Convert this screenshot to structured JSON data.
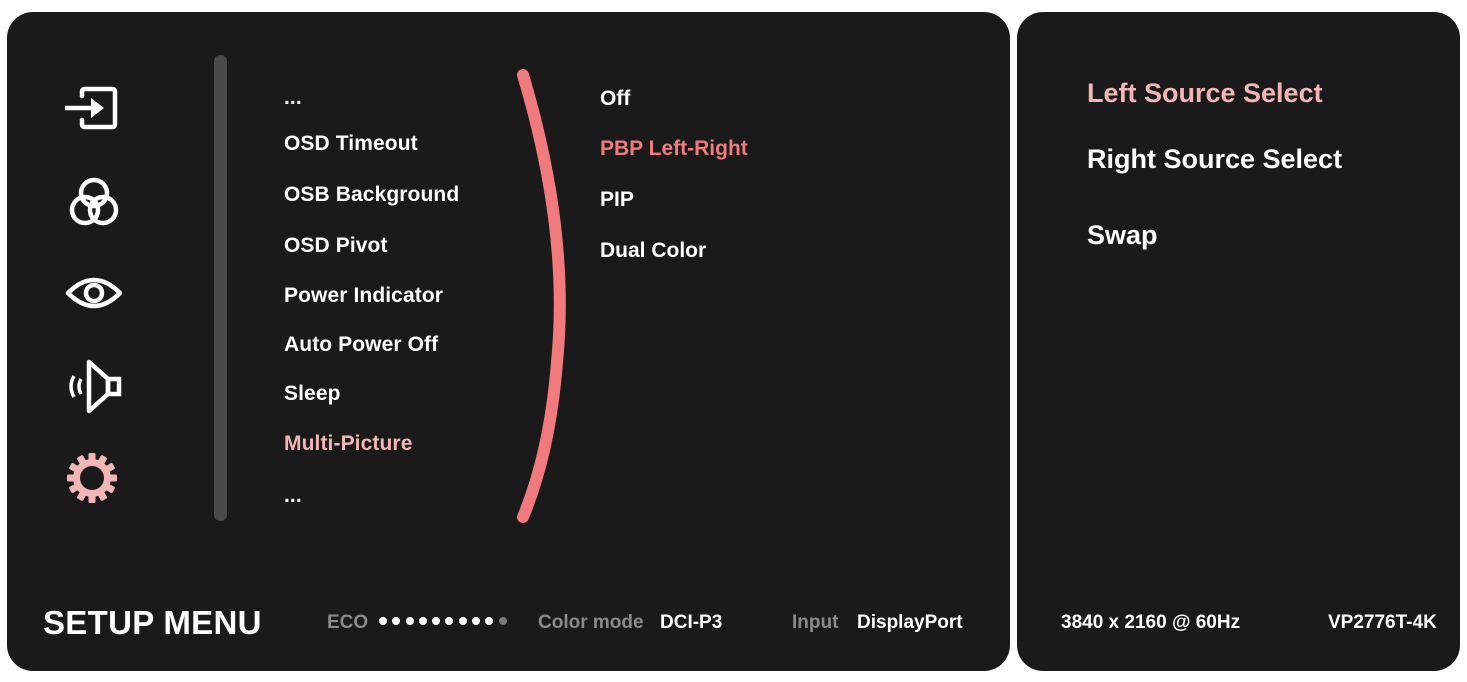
{
  "colors": {
    "panel_bg": "#1a1a1a",
    "active_pink": "#f2b6b6",
    "selected_coral": "#f07a7e",
    "scrollbar": "#4a4a4a",
    "muted_label": "#8a8a8a"
  },
  "sidebar": {
    "icons": [
      {
        "name": "input-source-icon",
        "active": false
      },
      {
        "name": "color-adjust-icon",
        "active": false
      },
      {
        "name": "view-mode-icon",
        "active": false
      },
      {
        "name": "audio-icon",
        "active": false
      },
      {
        "name": "setup-gear-icon",
        "active": true
      }
    ]
  },
  "menu": {
    "items": [
      {
        "label": "...",
        "active": false
      },
      {
        "label": "OSD Timeout",
        "active": false
      },
      {
        "label": "OSB Background",
        "active": false
      },
      {
        "label": "OSD Pivot",
        "active": false
      },
      {
        "label": "Power Indicator",
        "active": false
      },
      {
        "label": "Auto Power Off",
        "active": false
      },
      {
        "label": "Sleep",
        "active": false
      },
      {
        "label": "Multi-Picture",
        "active": true
      },
      {
        "label": "...",
        "active": false
      }
    ]
  },
  "submenu": {
    "items": [
      {
        "label": "Off",
        "selected": false
      },
      {
        "label": "PBP Left-Right",
        "selected": true
      },
      {
        "label": "PIP",
        "selected": false
      },
      {
        "label": "Dual Color",
        "selected": false
      }
    ]
  },
  "side_panel": {
    "items": [
      {
        "label": "Left Source Select",
        "active": true
      },
      {
        "label": "Right Source Select",
        "active": false
      },
      {
        "label": "Swap",
        "active": false
      }
    ],
    "resolution": "3840 x 2160 @ 60Hz",
    "model": "VP2776T-4K"
  },
  "footer": {
    "title": "SETUP MENU",
    "eco_label": "ECO",
    "eco_level": 9,
    "eco_max": 10,
    "color_mode_label": "Color mode",
    "color_mode_value": "DCI-P3",
    "input_label": "Input",
    "input_value": "DisplayPort"
  }
}
